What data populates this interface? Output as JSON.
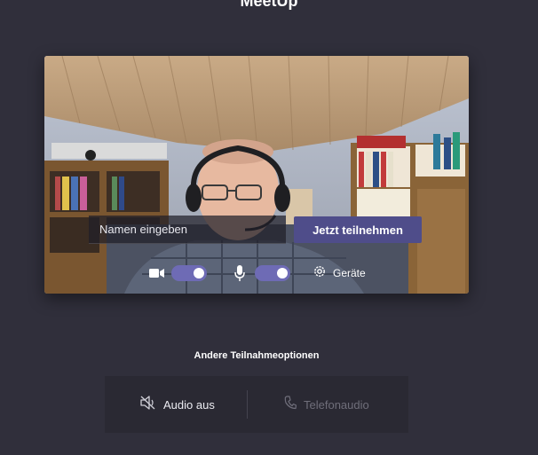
{
  "meeting": {
    "title": "MeetUp"
  },
  "prejoin": {
    "name_placeholder": "Namen eingeben",
    "join_label": "Jetzt teilnehmen",
    "camera": {
      "icon": "video-camera-icon",
      "enabled": true
    },
    "microphone": {
      "icon": "microphone-icon",
      "enabled": true
    },
    "devices": {
      "icon": "gear-icon",
      "label": "Geräte"
    }
  },
  "other_options": {
    "title": "Andere Teilnahmeoptionen",
    "audio_off": {
      "icon": "speaker-muted-icon",
      "label": "Audio aus"
    },
    "phone_audio": {
      "icon": "phone-icon",
      "label": "Telefonaudio",
      "disabled": true
    }
  },
  "footer": {
    "text": ""
  },
  "colors": {
    "background": "#302f3b",
    "accent": "#4f4d8a",
    "toggle_on": "#6e6bb5",
    "panel": "#2a2933"
  }
}
